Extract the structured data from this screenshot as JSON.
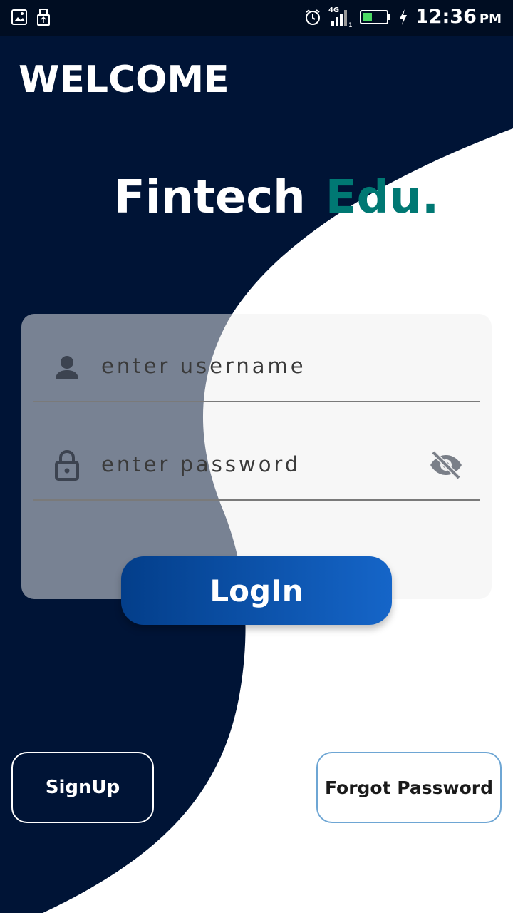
{
  "status_bar": {
    "network": "4G",
    "time": "12:36",
    "ampm": "PM"
  },
  "welcome_title": "WELCOME",
  "brand": {
    "part1": "Fintech",
    "part2": "Edu."
  },
  "form": {
    "username_placeholder": "enter username",
    "password_placeholder": "enter password"
  },
  "buttons": {
    "login": "LogIn",
    "signup": "SignUp",
    "forgot_password": "Forgot Password"
  },
  "colors": {
    "navy_background": "#001436",
    "brand_accent": "#007873",
    "login_gradient_start": "#033e8a",
    "login_gradient_end": "#1565c8"
  },
  "icons": [
    "image-icon",
    "usb-icon",
    "alarm-icon",
    "signal-icon",
    "battery-icon",
    "charging-icon",
    "person-icon",
    "lock-icon",
    "eye-off-icon"
  ]
}
